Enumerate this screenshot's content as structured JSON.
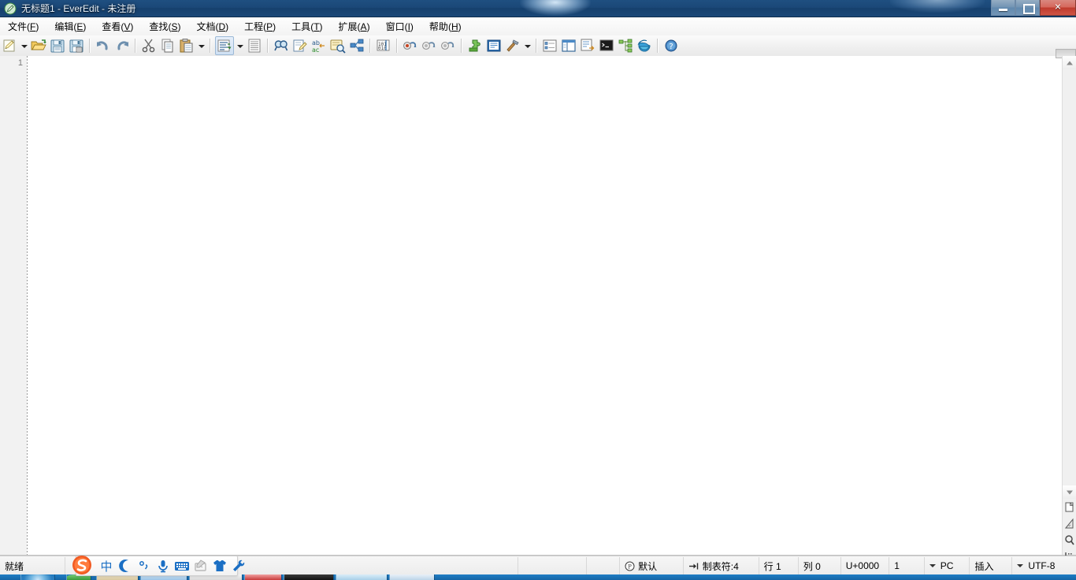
{
  "window": {
    "title": "无标题1 - EverEdit - 未注册",
    "icon": "everedit-pencil-icon",
    "controls": {
      "minimize": "最小化",
      "maximize": "最大化",
      "close": "关闭"
    }
  },
  "menubar": {
    "items": [
      {
        "label": "文件",
        "accel": "F",
        "name": "menu-file"
      },
      {
        "label": "编辑",
        "accel": "E",
        "name": "menu-edit"
      },
      {
        "label": "查看",
        "accel": "V",
        "name": "menu-view"
      },
      {
        "label": "查找",
        "accel": "S",
        "name": "menu-search"
      },
      {
        "label": "文档",
        "accel": "D",
        "name": "menu-document"
      },
      {
        "label": "工程",
        "accel": "P",
        "name": "menu-project"
      },
      {
        "label": "工具",
        "accel": "T",
        "name": "menu-tools"
      },
      {
        "label": "扩展",
        "accel": "A",
        "name": "menu-addons"
      },
      {
        "label": "窗口",
        "accel": "I",
        "name": "menu-window"
      },
      {
        "label": "帮助",
        "accel": "H",
        "name": "menu-help"
      }
    ]
  },
  "toolbar": {
    "buttons": [
      {
        "name": "new-file-icon",
        "tip": "新建"
      },
      {
        "name": "new-file-dropdown-arrow-icon",
        "tip": "新建下拉"
      },
      {
        "name": "open-file-icon",
        "tip": "打开"
      },
      {
        "name": "save-icon",
        "tip": "保存"
      },
      {
        "name": "save-as-icon",
        "tip": "另存为"
      },
      {
        "name": "undo-icon",
        "tip": "撤销"
      },
      {
        "name": "redo-icon",
        "tip": "重做"
      },
      {
        "name": "cut-icon",
        "tip": "剪切"
      },
      {
        "name": "copy-icon",
        "tip": "复制"
      },
      {
        "name": "paste-icon",
        "tip": "粘贴"
      },
      {
        "name": "paste-dropdown-arrow-icon",
        "tip": "粘贴下拉"
      },
      {
        "name": "sort-lines-icon",
        "tip": "排序"
      },
      {
        "name": "sort-dropdown-arrow-icon",
        "tip": "排序下拉"
      },
      {
        "name": "wrap-lines-icon",
        "tip": "自动换行"
      },
      {
        "name": "find-icon",
        "tip": "查找"
      },
      {
        "name": "replace-icon",
        "tip": "替换"
      },
      {
        "name": "find-in-files-icon",
        "tip": "在文件中查找"
      },
      {
        "name": "find-next-icon",
        "tip": "查找下一个"
      },
      {
        "name": "mark-icon",
        "tip": "标记"
      },
      {
        "name": "column-mode-icon",
        "tip": "列模式"
      },
      {
        "name": "bookmark-toggle-icon",
        "tip": "书签"
      },
      {
        "name": "bookmark-prev-icon",
        "tip": "上一个书签"
      },
      {
        "name": "bookmark-next-icon",
        "tip": "下一个书签"
      },
      {
        "name": "plugin-icon",
        "tip": "插件"
      },
      {
        "name": "snippets-icon",
        "tip": "代码片段"
      },
      {
        "name": "tools-hammer-icon",
        "tip": "工具"
      },
      {
        "name": "tools-dropdown-arrow-icon",
        "tip": "工具下拉"
      },
      {
        "name": "symbol-list-icon",
        "tip": "符号列表"
      },
      {
        "name": "project-panel-icon",
        "tip": "工程面板"
      },
      {
        "name": "output-panel-icon",
        "tip": "输出面板"
      },
      {
        "name": "console-icon",
        "tip": "控制台"
      },
      {
        "name": "file-tree-icon",
        "tip": "文件树"
      },
      {
        "name": "browser-preview-icon",
        "tip": "浏览器预览"
      },
      {
        "name": "help-icon",
        "tip": "帮助"
      }
    ]
  },
  "editor": {
    "line_numbers": [
      "1"
    ],
    "content": "",
    "current_line_highlight_color": "#ddfdff"
  },
  "scrollbar": {
    "up_arrow": "scroll-up-arrow-icon",
    "down_arrow": "scroll-down-arrow-icon",
    "quick_icons": [
      {
        "name": "document-map-icon"
      },
      {
        "name": "pencil-ruler-icon"
      },
      {
        "name": "magnifier-icon"
      },
      {
        "name": "selection-grid-icon"
      }
    ]
  },
  "statusbar": {
    "ready": "就绪",
    "syntax_icon": "parser-icon",
    "syntax": "默认",
    "tab_icon": "tab-arrow-icon",
    "tab_width": "制表符:4",
    "line": "行 1",
    "column": "列 0",
    "unicode": "U+0000",
    "byte_count": "1",
    "eol": "PC",
    "insert_mode": "插入",
    "encoding": "UTF-8"
  },
  "ime": {
    "name": "搜狗拼音输入法",
    "logo": "sogou-logo-icon",
    "items": [
      {
        "name": "ime-chinese-mode-icon",
        "label": "中"
      },
      {
        "name": "ime-moon-icon",
        "label": "☾"
      },
      {
        "name": "ime-fullwidth-punct-icon",
        "label": "°,"
      },
      {
        "name": "ime-voice-input-icon",
        "label": "🎤"
      },
      {
        "name": "ime-soft-keyboard-icon",
        "label": "⌨"
      },
      {
        "name": "ime-handwriting-icon",
        "label": "✍"
      },
      {
        "name": "ime-skin-icon",
        "label": "👕"
      },
      {
        "name": "ime-toolbox-icon",
        "label": "🔧"
      }
    ]
  },
  "theme": {
    "title_bar": "#1b4878",
    "accent": "#2e6da4",
    "toolbar_bg": "#f0f0f0",
    "status_bg": "#ececec",
    "gutter_bg": "#f2f2f2"
  }
}
